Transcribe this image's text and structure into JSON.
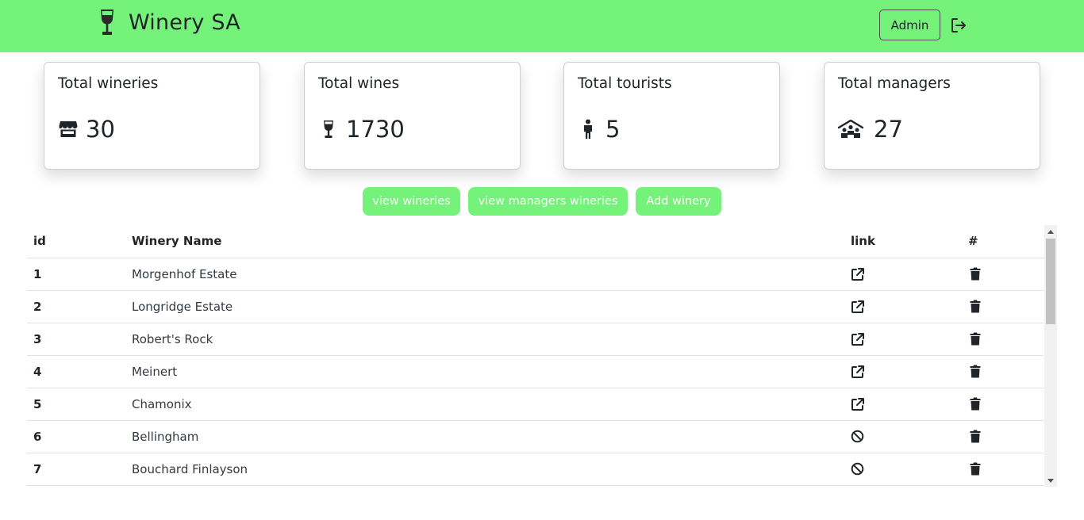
{
  "header": {
    "brand_title": "Winery SA",
    "brand_icon": "wine-glass-icon",
    "admin_label": "Admin",
    "logout_icon": "logout-icon"
  },
  "stats": [
    {
      "title": "Total wineries",
      "value": "30",
      "icon": "store-icon"
    },
    {
      "title": "Total wines",
      "value": "1730",
      "icon": "wine-glass-icon"
    },
    {
      "title": "Total tourists",
      "value": "5",
      "icon": "person-icon"
    },
    {
      "title": "Total managers",
      "value": "27",
      "icon": "people-roof-icon"
    }
  ],
  "actions": {
    "view_wineries": "view wineries",
    "view_managers_wineries": "view managers wineries",
    "add_winery": "Add winery"
  },
  "table": {
    "columns": [
      "id",
      "Winery Name",
      "link",
      "#"
    ],
    "rows": [
      {
        "id": "1",
        "name": "Morgenhof Estate",
        "link": "external-link-icon"
      },
      {
        "id": "2",
        "name": "Longridge Estate",
        "link": "external-link-icon"
      },
      {
        "id": "3",
        "name": "Robert's Rock",
        "link": "external-link-icon"
      },
      {
        "id": "4",
        "name": "Meinert",
        "link": "external-link-icon"
      },
      {
        "id": "5",
        "name": "Chamonix",
        "link": "external-link-icon"
      },
      {
        "id": "6",
        "name": "Bellingham",
        "link": "ban-icon"
      },
      {
        "id": "7",
        "name": "Bouchard Finlayson",
        "link": "ban-icon"
      }
    ]
  },
  "colors": {
    "accent": "#75f27a",
    "text": "#212529"
  }
}
